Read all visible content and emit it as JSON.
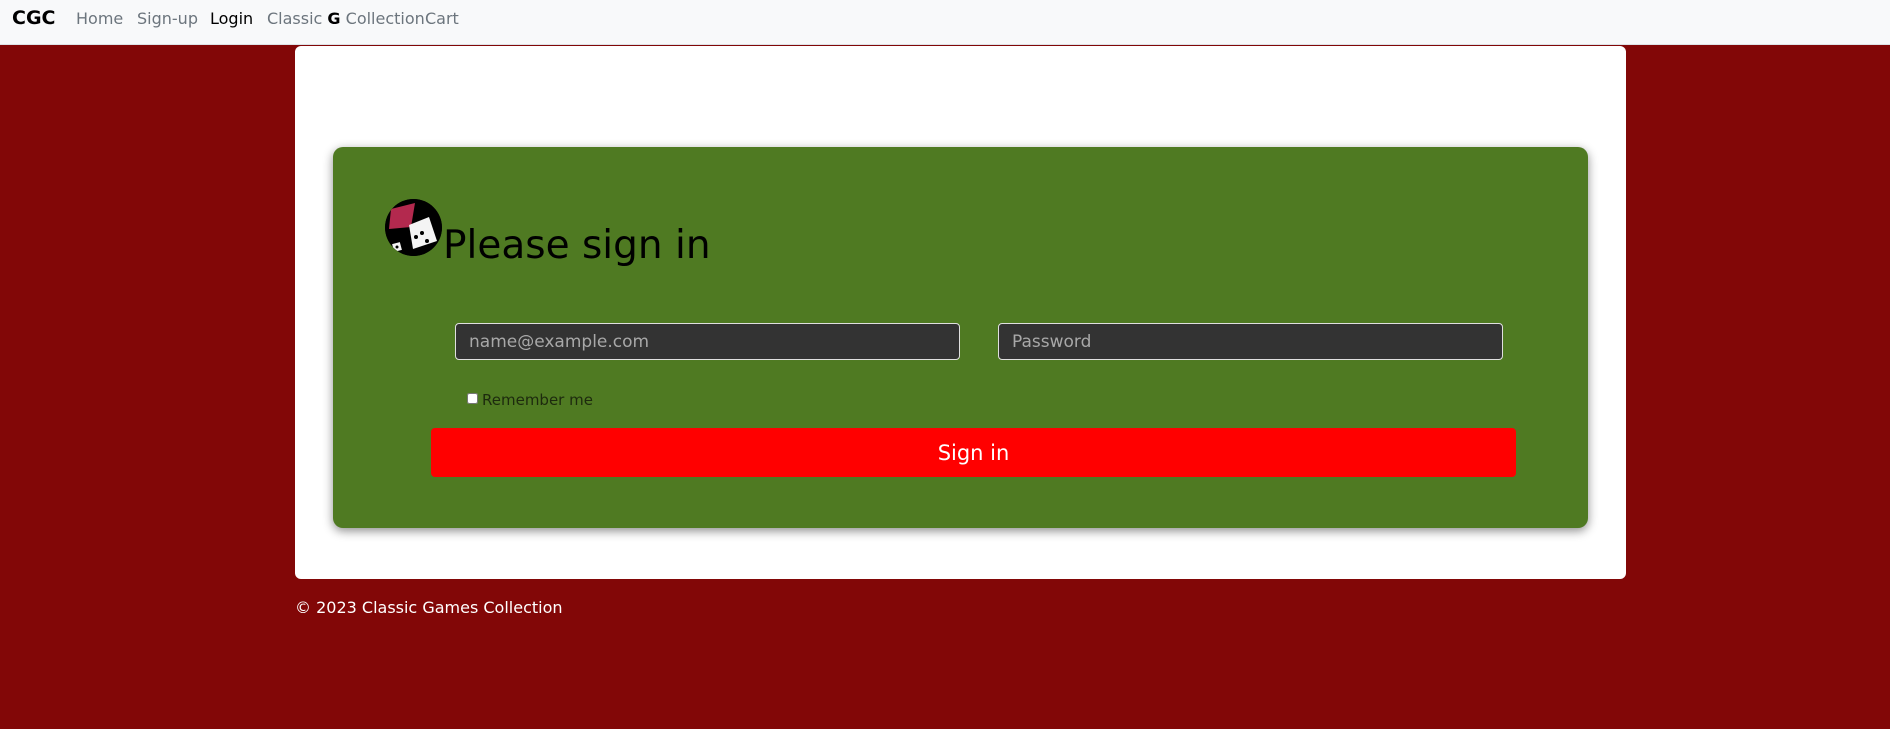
{
  "navbar": {
    "brand": "CGC",
    "links": [
      {
        "label": "Home"
      },
      {
        "label": "Sign-up"
      },
      {
        "label": "Login"
      },
      {
        "label_before": "Classic ",
        "label_bold": "G",
        "label_after": " Collection"
      },
      {
        "label": "Cart"
      }
    ]
  },
  "form": {
    "logo_icon": "playing-cards-logo-icon",
    "heading": "Please sign in",
    "email_placeholder": "name@example.com",
    "password_placeholder": "Password",
    "remember_label": "Remember me",
    "remember_checked": false,
    "submit_label": "Sign in"
  },
  "footer": {
    "text": "© 2023 Classic Games Collection"
  },
  "colors": {
    "page_background": "#820707",
    "panel_background": "#4f7a22",
    "button_background": "#ff0000",
    "input_background": "#333333"
  }
}
